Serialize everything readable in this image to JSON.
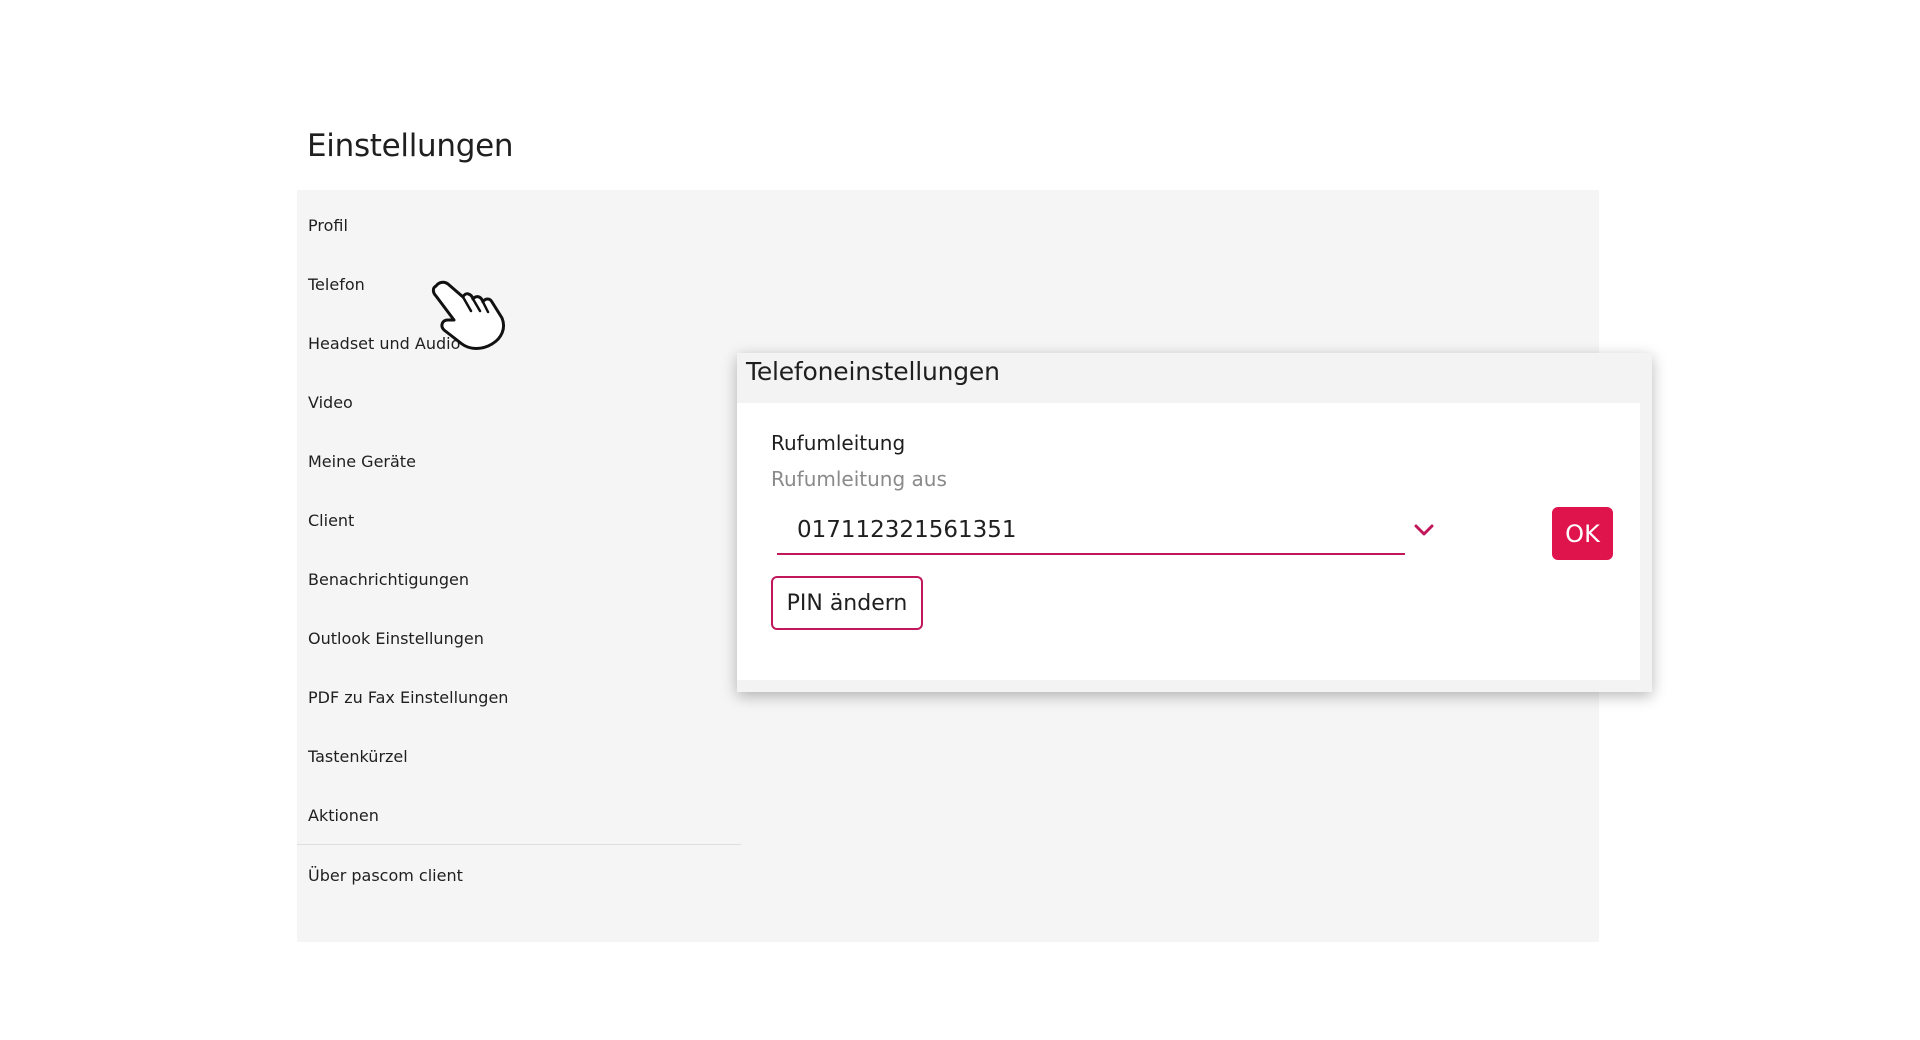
{
  "page": {
    "title": "Einstellungen"
  },
  "sidebar": {
    "items": [
      {
        "label": "Profil"
      },
      {
        "label": "Telefon"
      },
      {
        "label": "Headset und Audio"
      },
      {
        "label": "Video"
      },
      {
        "label": "Meine Geräte"
      },
      {
        "label": "Client"
      },
      {
        "label": "Benachrichtigungen"
      },
      {
        "label": "Outlook Einstellungen"
      },
      {
        "label": "PDF zu Fax Einstellungen"
      },
      {
        "label": "Tastenkürzel"
      },
      {
        "label": "Aktionen"
      },
      {
        "label": "Über pascom client"
      }
    ]
  },
  "dialog": {
    "title": "Telefoneinstellungen",
    "section_label": "Rufumleitung",
    "section_status": "Rufumleitung aus",
    "number_value": "017112321561351",
    "ok_label": "OK",
    "pin_label": "PIN ändern"
  },
  "colors": {
    "accent": "#e0144c",
    "accent_border": "#c2185b",
    "panel_bg": "#f5f5f5"
  },
  "icons": {
    "cursor": "hand-pointer-icon",
    "dropdown": "chevron-down-icon"
  }
}
